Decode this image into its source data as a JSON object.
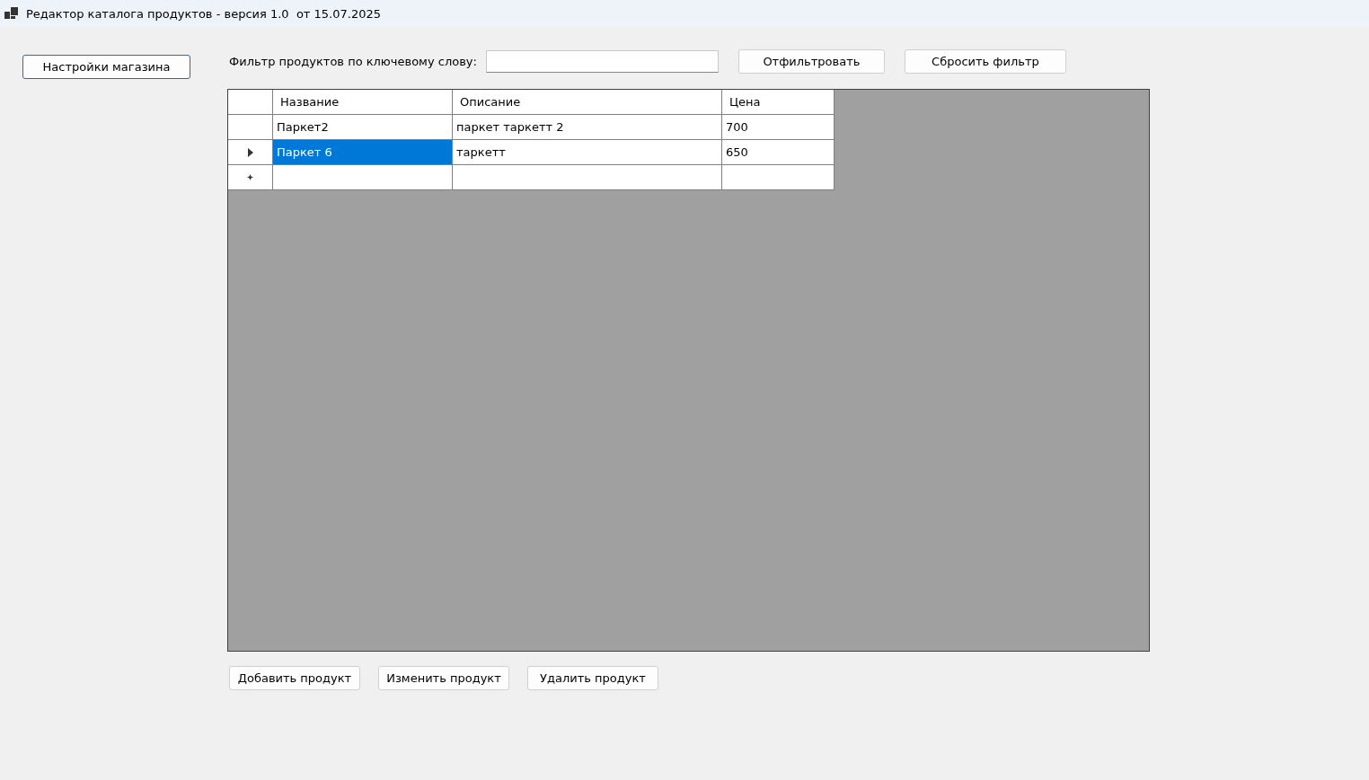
{
  "window": {
    "title": "Редактор каталога продуктов - версия 1.0  от 15.07.2025"
  },
  "settings_button": "Настройки магазина",
  "filter": {
    "label": "Фильтр продуктов по ключевому слову:",
    "apply_button": "Отфильтровать",
    "reset_button": "Сбросить фильтр"
  },
  "table": {
    "columns": [
      "Название",
      "Описание",
      "Цена"
    ],
    "rows": [
      {
        "kind": "data",
        "current": false,
        "cells": [
          {
            "text": "Паркет2",
            "selected": false
          },
          {
            "text": "паркет таркетт 2",
            "selected": false
          },
          {
            "text": "700",
            "selected": false
          }
        ]
      },
      {
        "kind": "data",
        "current": true,
        "cells": [
          {
            "text": "Паркет 6",
            "selected": true
          },
          {
            "text": "таркетт",
            "selected": false
          },
          {
            "text": "650",
            "selected": false
          }
        ]
      },
      {
        "kind": "new",
        "current": false
      }
    ]
  },
  "buttons": [
    "Добавить продукт",
    "Изменить продукт",
    "Удалить продукт"
  ]
}
